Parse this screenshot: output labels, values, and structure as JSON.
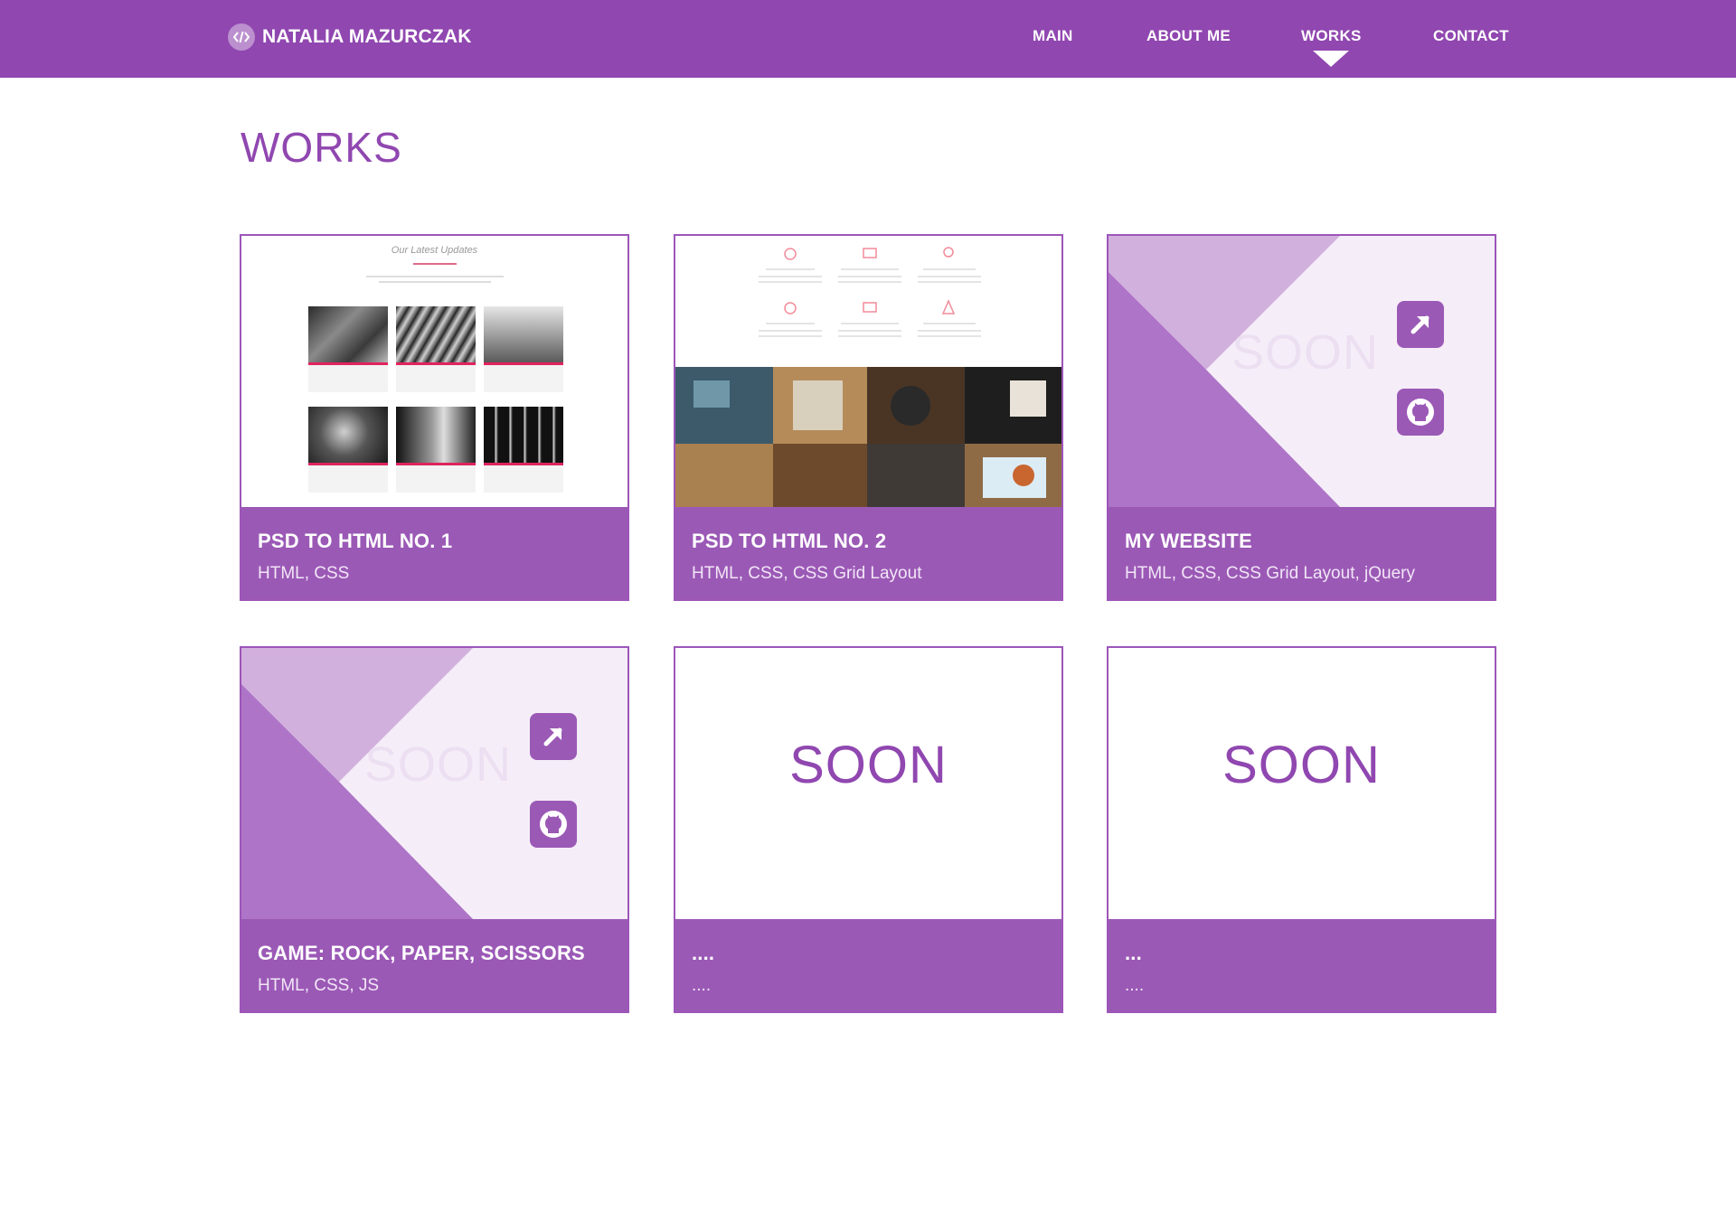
{
  "header": {
    "logo_text": "NATALIA MAZURCZAK",
    "nav": [
      {
        "label": "MAIN"
      },
      {
        "label": "ABOUT ME"
      },
      {
        "label": "WORKS"
      },
      {
        "label": "CONTACT"
      }
    ],
    "active_nav": "WORKS"
  },
  "page": {
    "title": "WORKS"
  },
  "projects": [
    {
      "title": "PSD TO HTML NO. 1",
      "tags": "HTML, CSS",
      "thumb": "screenshot",
      "thumb_caption": "Our Latest Updates"
    },
    {
      "title": "PSD TO HTML NO. 2",
      "tags": "HTML, CSS, CSS Grid Layout",
      "thumb": "screenshot"
    },
    {
      "title": "MY WEBSITE",
      "tags": "HTML, CSS, CSS Grid Layout, jQuery",
      "thumb": "placeholder",
      "thumb_text": "SOON",
      "icons": [
        "external-link-icon",
        "github-icon"
      ]
    },
    {
      "title": "GAME: ROCK, PAPER, SCISSORS",
      "tags": "HTML, CSS, JS",
      "thumb": "placeholder",
      "thumb_text": "SOON",
      "icons": [
        "external-link-icon",
        "github-icon"
      ]
    },
    {
      "title": "....",
      "tags": "....",
      "thumb": "soon",
      "thumb_text": "SOON"
    },
    {
      "title": "...",
      "tags": "....",
      "thumb": "soon",
      "thumb_text": "SOON"
    }
  ],
  "colors": {
    "brand": "#9047b0",
    "card_footer": "#9b59b6",
    "triangle_light": "#d2b0dd",
    "triangle_mid": "#ae74c7",
    "placeholder_bg": "#f5eef8"
  }
}
